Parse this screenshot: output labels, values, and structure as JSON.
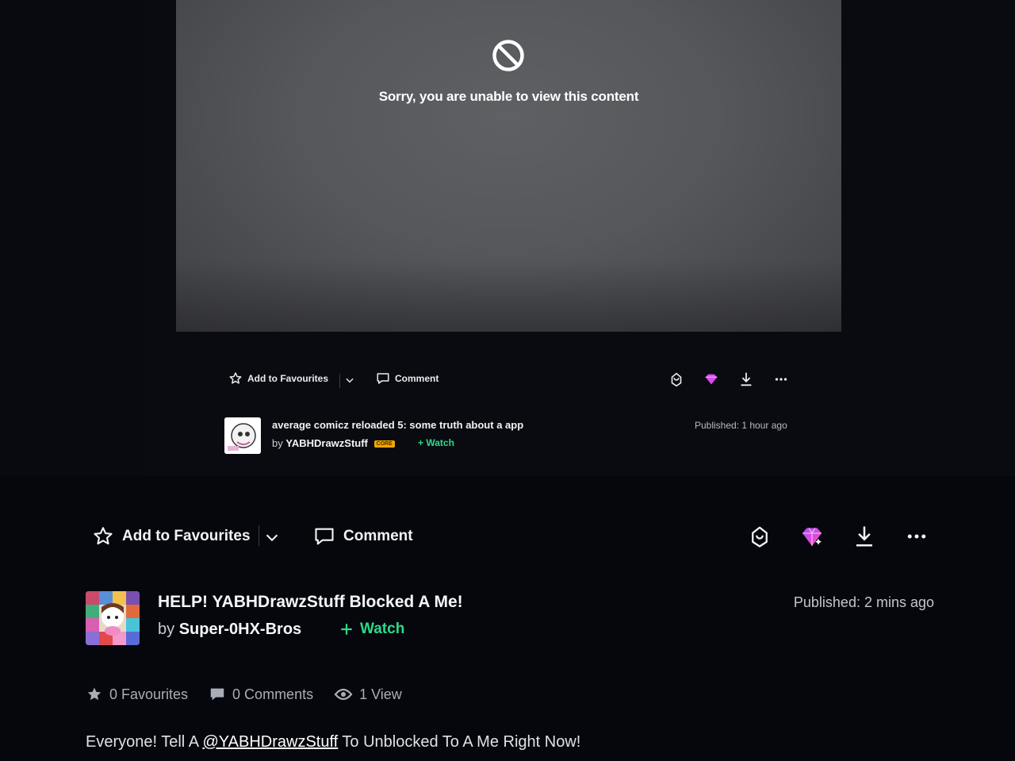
{
  "embedded_screenshot": {
    "blocked_message": "Sorry, you are unable to view this content",
    "action_bar": {
      "favourite_label": "Add to Favourites",
      "comment_label": "Comment"
    },
    "deviation": {
      "title": "average comicz reloaded 5: some truth about a app",
      "by_prefix": "by",
      "author": "YABHDrawzStuff",
      "badge": "CORE",
      "watch_label": "Watch",
      "published": "Published: 1 hour ago"
    }
  },
  "action_bar": {
    "favourite_label": "Add to Favourites",
    "comment_label": "Comment",
    "icons": [
      "gift-icon",
      "core-gem-icon",
      "download-icon",
      "more-icon"
    ]
  },
  "deviation": {
    "title": "HELP! YABHDrawzStuff Blocked A Me!",
    "by_prefix": "by",
    "author": "Super-0HX-Bros",
    "watch_label": "Watch",
    "published": "Published: 2 mins ago"
  },
  "stats": {
    "favourites": "0 Favourites",
    "comments": "0 Comments",
    "views": "1 View"
  },
  "description": {
    "before": "Everyone! Tell A ",
    "mention": "@YABHDrawzStuff",
    "after": " To Unblocked To A Me Right Now!"
  },
  "colors": {
    "background": "#06070d",
    "accent_green": "#2fd988",
    "gem_pink": "#d94bf0"
  }
}
